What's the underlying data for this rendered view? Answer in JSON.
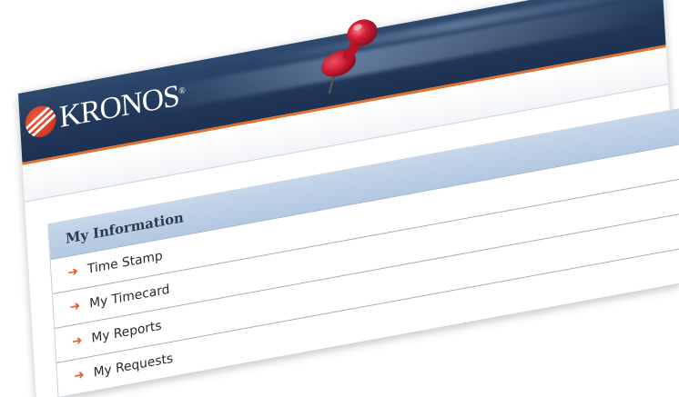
{
  "brand": {
    "name": "KRONOS",
    "trademark": "®",
    "logo_icon": "kronos-logo-icon",
    "colors": {
      "header": "#22385a",
      "accent": "#e5702a",
      "menu_header": "#b9cce3"
    }
  },
  "menu": {
    "title": "My Information",
    "items": [
      {
        "label": "Time Stamp",
        "icon": "arrow-right-icon"
      },
      {
        "label": "My Timecard",
        "icon": "arrow-right-icon"
      },
      {
        "label": "My Reports",
        "icon": "arrow-right-icon"
      },
      {
        "label": "My Requests",
        "icon": "arrow-right-icon"
      }
    ]
  },
  "decor": {
    "pin_icon": "push-pin-icon",
    "pin_color": "#d21f35"
  }
}
